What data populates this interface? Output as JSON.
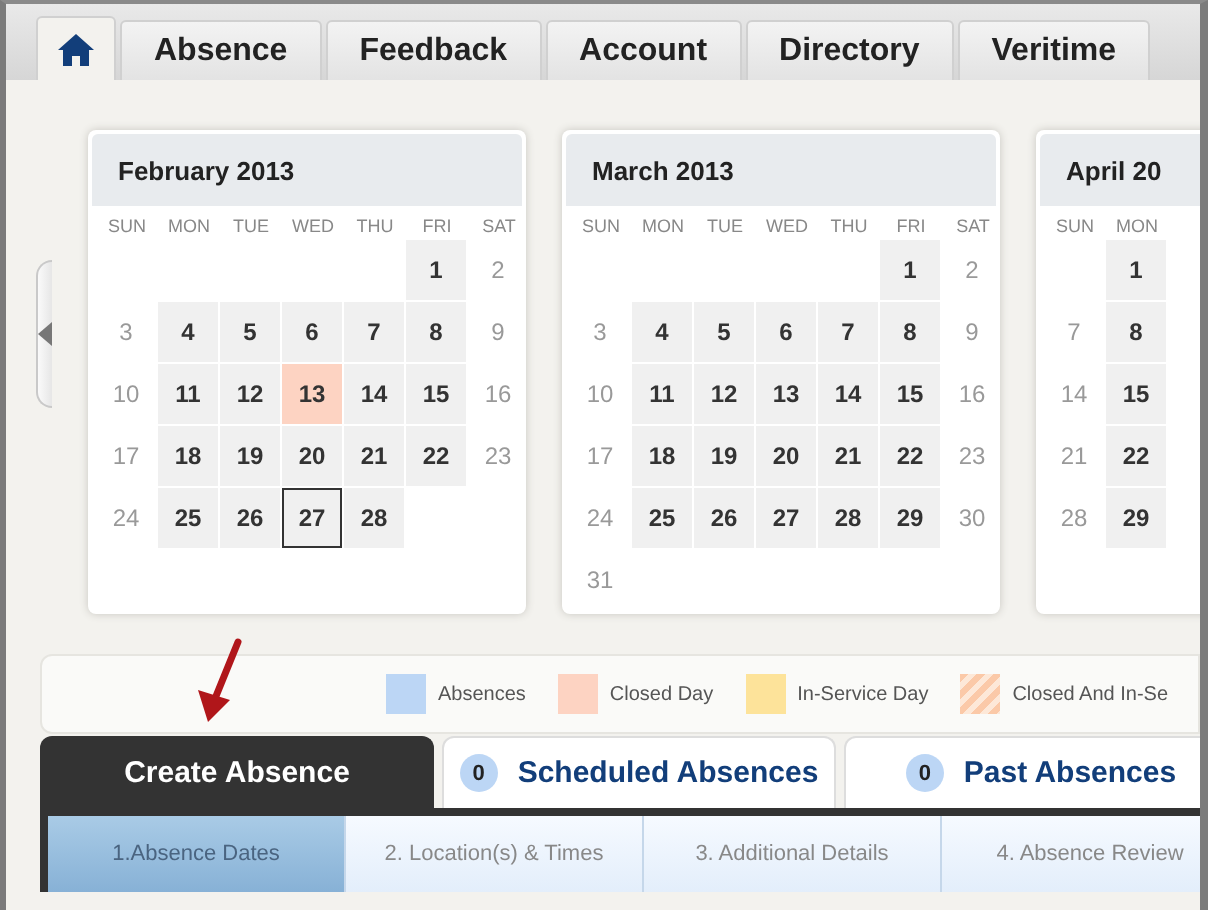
{
  "nav_tabs": [
    {
      "kind": "home",
      "selected": true
    },
    {
      "label": "Absence",
      "selected": false
    },
    {
      "label": "Feedback",
      "selected": false
    },
    {
      "label": "Account",
      "selected": false
    },
    {
      "label": "Directory",
      "selected": false
    },
    {
      "label": "Veritime",
      "selected": false
    }
  ],
  "calendars": [
    {
      "title": "February 2013",
      "weekdays": [
        "SUN",
        "MON",
        "TUE",
        "WED",
        "THU",
        "FRI",
        "SAT"
      ],
      "weeks": [
        [
          {
            "kind": "blank"
          },
          {
            "kind": "blank"
          },
          {
            "kind": "blank"
          },
          {
            "kind": "blank"
          },
          {
            "kind": "blank"
          },
          {
            "day": "1",
            "kind": "workday"
          },
          {
            "day": "2",
            "kind": "weekend"
          }
        ],
        [
          {
            "day": "3",
            "kind": "weekend"
          },
          {
            "day": "4",
            "kind": "workday"
          },
          {
            "day": "5",
            "kind": "workday"
          },
          {
            "day": "6",
            "kind": "workday"
          },
          {
            "day": "7",
            "kind": "workday"
          },
          {
            "day": "8",
            "kind": "workday"
          },
          {
            "day": "9",
            "kind": "weekend"
          }
        ],
        [
          {
            "day": "10",
            "kind": "weekend"
          },
          {
            "day": "11",
            "kind": "workday"
          },
          {
            "day": "12",
            "kind": "workday"
          },
          {
            "day": "13",
            "kind": "closed"
          },
          {
            "day": "14",
            "kind": "workday"
          },
          {
            "day": "15",
            "kind": "workday"
          },
          {
            "day": "16",
            "kind": "weekend"
          }
        ],
        [
          {
            "day": "17",
            "kind": "weekend"
          },
          {
            "day": "18",
            "kind": "workday"
          },
          {
            "day": "19",
            "kind": "workday"
          },
          {
            "day": "20",
            "kind": "workday"
          },
          {
            "day": "21",
            "kind": "workday"
          },
          {
            "day": "22",
            "kind": "workday"
          },
          {
            "day": "23",
            "kind": "weekend"
          }
        ],
        [
          {
            "day": "24",
            "kind": "weekend"
          },
          {
            "day": "25",
            "kind": "workday"
          },
          {
            "day": "26",
            "kind": "workday"
          },
          {
            "day": "27",
            "kind": "today"
          },
          {
            "day": "28",
            "kind": "workday"
          }
        ]
      ]
    },
    {
      "title": "March 2013",
      "weekdays": [
        "SUN",
        "MON",
        "TUE",
        "WED",
        "THU",
        "FRI",
        "SAT"
      ],
      "weeks": [
        [
          {
            "kind": "blank"
          },
          {
            "kind": "blank"
          },
          {
            "kind": "blank"
          },
          {
            "kind": "blank"
          },
          {
            "kind": "blank"
          },
          {
            "day": "1",
            "kind": "workday"
          },
          {
            "day": "2",
            "kind": "weekend"
          }
        ],
        [
          {
            "day": "3",
            "kind": "weekend"
          },
          {
            "day": "4",
            "kind": "workday"
          },
          {
            "day": "5",
            "kind": "workday"
          },
          {
            "day": "6",
            "kind": "workday"
          },
          {
            "day": "7",
            "kind": "workday"
          },
          {
            "day": "8",
            "kind": "workday"
          },
          {
            "day": "9",
            "kind": "weekend"
          }
        ],
        [
          {
            "day": "10",
            "kind": "weekend"
          },
          {
            "day": "11",
            "kind": "workday"
          },
          {
            "day": "12",
            "kind": "workday"
          },
          {
            "day": "13",
            "kind": "workday"
          },
          {
            "day": "14",
            "kind": "workday"
          },
          {
            "day": "15",
            "kind": "workday"
          },
          {
            "day": "16",
            "kind": "weekend"
          }
        ],
        [
          {
            "day": "17",
            "kind": "weekend"
          },
          {
            "day": "18",
            "kind": "workday"
          },
          {
            "day": "19",
            "kind": "workday"
          },
          {
            "day": "20",
            "kind": "workday"
          },
          {
            "day": "21",
            "kind": "workday"
          },
          {
            "day": "22",
            "kind": "workday"
          },
          {
            "day": "23",
            "kind": "weekend"
          }
        ],
        [
          {
            "day": "24",
            "kind": "weekend"
          },
          {
            "day": "25",
            "kind": "workday"
          },
          {
            "day": "26",
            "kind": "workday"
          },
          {
            "day": "27",
            "kind": "workday"
          },
          {
            "day": "28",
            "kind": "workday"
          },
          {
            "day": "29",
            "kind": "workday"
          },
          {
            "day": "30",
            "kind": "weekend"
          }
        ],
        [
          {
            "day": "31",
            "kind": "weekend"
          }
        ]
      ]
    },
    {
      "title": "April 20",
      "weekdays": [
        "SUN",
        "MON"
      ],
      "weeks": [
        [
          {
            "kind": "blank"
          },
          {
            "day": "1",
            "kind": "workday"
          }
        ],
        [
          {
            "day": "7",
            "kind": "weekend"
          },
          {
            "day": "8",
            "kind": "workday"
          }
        ],
        [
          {
            "day": "14",
            "kind": "weekend"
          },
          {
            "day": "15",
            "kind": "workday"
          }
        ],
        [
          {
            "day": "21",
            "kind": "weekend"
          },
          {
            "day": "22",
            "kind": "workday"
          }
        ],
        [
          {
            "day": "28",
            "kind": "weekend"
          },
          {
            "day": "29",
            "kind": "workday"
          }
        ]
      ]
    }
  ],
  "legend": [
    {
      "label": "Absences",
      "color": "#bcd6f5",
      "kind": "solid"
    },
    {
      "label": "Closed Day",
      "color": "#fdd3c2",
      "kind": "solid"
    },
    {
      "label": "In-Service Day",
      "color": "#fde39a",
      "kind": "solid"
    },
    {
      "label": "Closed And In-Se",
      "color": "#fbc9a8",
      "kind": "hatched"
    }
  ],
  "absence_tabs": [
    {
      "label": "Create Absence",
      "selected": true
    },
    {
      "label": "Scheduled Absences",
      "count": "0",
      "selected": false
    },
    {
      "label": "Past Absences",
      "count": "0",
      "selected": false
    }
  ],
  "steps": [
    {
      "label": "1.Absence Dates",
      "selected": true
    },
    {
      "label": "2. Location(s) & Times",
      "selected": false
    },
    {
      "label": "3. Additional Details",
      "selected": false
    },
    {
      "label": "4. Absence Review",
      "selected": false
    }
  ]
}
